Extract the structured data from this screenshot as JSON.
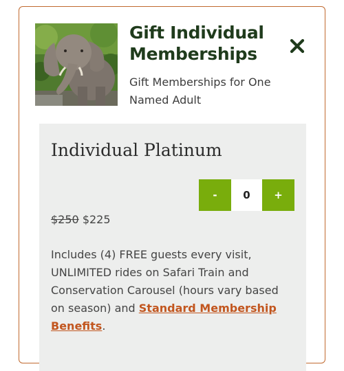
{
  "modal": {
    "title": "Gift Individual Memberships",
    "subtitle": "Gift Memberships for One Named Adult",
    "close_icon": "close-icon",
    "image_alt": "elephant"
  },
  "plan": {
    "name": "Individual Platinum",
    "quantity": {
      "decrement_label": "-",
      "value": "0",
      "increment_label": "+"
    },
    "original_price": "$250",
    "sale_price": "$225",
    "description_text": "Includes (4) FREE guests every visit, UNLIMITED rides on Safari Train and Conservation Carousel (hours vary based on season) and ",
    "benefits_link": "Standard Membership Benefits",
    "description_end": "."
  },
  "colors": {
    "border": "#c0692e",
    "title": "#1f3b1c",
    "accent_green": "#79ad0c",
    "link": "#c2561f",
    "panel_bg": "#edeeed"
  }
}
